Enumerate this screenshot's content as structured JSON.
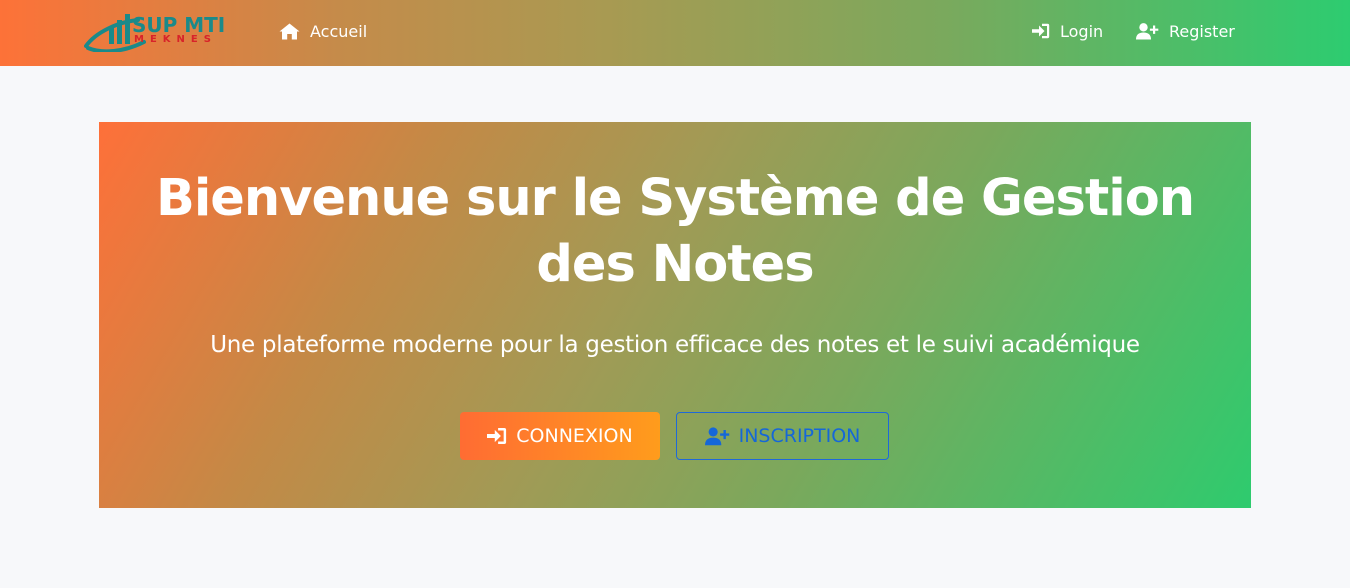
{
  "navbar": {
    "logo": {
      "line1": "SUP MTI",
      "line2": "MEKNES"
    },
    "home_label": "Accueil",
    "login_label": "Login",
    "register_label": "Register"
  },
  "hero": {
    "title": "Bienvenue sur le Système de Gestion des Notes",
    "subtitle": "Une plateforme moderne pour la gestion efficace des notes et le suivi académique",
    "connexion_label": "CONNEXION",
    "inscription_label": "INSCRIPTION"
  },
  "icons": {
    "home": "home-icon",
    "login": "sign-in-icon",
    "register": "user-plus-icon"
  },
  "colors": {
    "gradient_start": "#fd7238",
    "gradient_end": "#2dcc70",
    "connexion_start": "#ff6c33",
    "connexion_end": "#ff9c1c",
    "inscription_accent": "#1567d8",
    "logo_teal": "#1a8a8a",
    "logo_red": "#d8232a",
    "page_background": "#f7f8fa"
  }
}
